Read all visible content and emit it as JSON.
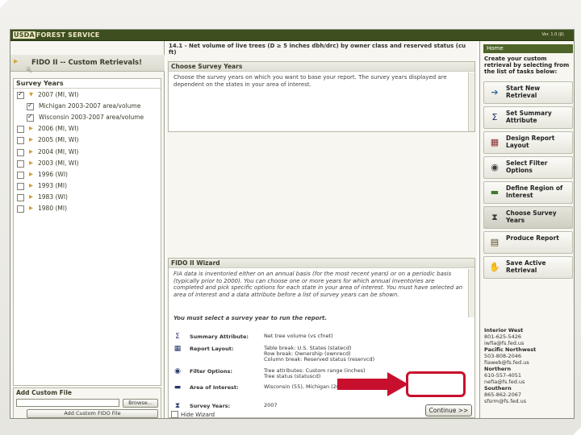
{
  "header": {
    "brand_usda": "USDA",
    "brand_name": "FOREST SERVICE",
    "version": "Ver. 1.0 (β)"
  },
  "left": {
    "title": "FIDO II -- Custom Retrievals!",
    "tree_header": "Survey Years",
    "rows": [
      {
        "label": "2007 (MI, WI)",
        "checked": true,
        "indent": 0,
        "expanded": true
      },
      {
        "label": "Michigan 2003-2007 area/volume",
        "checked": true,
        "indent": 1
      },
      {
        "label": "Wisconsin 2003-2007 area/volume",
        "checked": true,
        "indent": 1
      },
      {
        "label": "2006 (MI, WI)",
        "checked": false,
        "indent": 0
      },
      {
        "label": "2005 (MI, WI)",
        "checked": false,
        "indent": 0
      },
      {
        "label": "2004 (MI, WI)",
        "checked": false,
        "indent": 0
      },
      {
        "label": "2003 (MI, WI)",
        "checked": false,
        "indent": 0
      },
      {
        "label": "1996 (WI)",
        "checked": false,
        "indent": 0
      },
      {
        "label": "1993 (MI)",
        "checked": false,
        "indent": 0
      },
      {
        "label": "1983 (WI)",
        "checked": false,
        "indent": 0
      },
      {
        "label": "1980 (MI)",
        "checked": false,
        "indent": 0
      }
    ],
    "add_file": {
      "title": "Add Custom File",
      "browse_label": "Browse...",
      "add_label": "Add Custom FIDO File"
    }
  },
  "middle": {
    "report_title": "14.1 - Net volume of live trees (D ≥ 5 inches dbh/drc) by owner class and reserved status (cu ft)",
    "choose": {
      "title": "Choose Survey Years",
      "text": "Choose the survey years on which you want to base your report. The survey years displayed are dependent on the states in your area of interest."
    },
    "wizard": {
      "title": "FIDO II Wizard",
      "text": "FIA data is inventoried either on an annual basis (for the most recent years) or on a periodic basis (typically prior to 2000). You can choose one or more years for which annual inventories are completed and pick specific options for each state in your area of interest. You must have selected an area of interest and a data attribute before a list of survey years can be shown.",
      "must": "You must select a survey year to run the report.",
      "summary": [
        {
          "icon": "sigma-icon",
          "glyph": "Σ",
          "label": "Summary Attribute:",
          "value": "Net tree volume (vs cfnet)"
        },
        {
          "icon": "layout-icon",
          "glyph": "▦",
          "label": "Report Layout:",
          "value": "Table break: U.S. States (statecd)|Row break: Ownership (ownrecd)|Column break: Reserved status (reservcd)"
        },
        {
          "icon": "filter-icon",
          "glyph": "◉",
          "label": "Filter Options:",
          "value": "Tree attributes: Custom range (inches)|Tree status (statuscd)"
        },
        {
          "icon": "map-icon",
          "glyph": "▬",
          "label": "Area of Interest:",
          "value": "Wisconsin (55), Michigan (26)"
        },
        {
          "icon": "hourglass-icon",
          "glyph": "⧗",
          "label": "Survey Years:",
          "value": "2007"
        }
      ],
      "hide_label": "Hide Wizard",
      "continue_label": "Continue >>"
    }
  },
  "right": {
    "home_label": "Home",
    "intro": "Create your custom retrieval by selecting from the list of tasks below:",
    "tasks": [
      {
        "label": "Start New Retrieval",
        "icon": "start-icon",
        "glyph": "➔",
        "color": "#2c6aa0"
      },
      {
        "label": "Set Summary Attribute",
        "icon": "sigma-icon",
        "glyph": "Σ",
        "color": "#1c2e66"
      },
      {
        "label": "Design Report Layout",
        "icon": "layout-icon",
        "glyph": "▦",
        "color": "#8a2c2c"
      },
      {
        "label": "Select Filter Options",
        "icon": "filter-icon",
        "glyph": "◉",
        "color": "#3a3a3a"
      },
      {
        "label": "Define Region of Interest",
        "icon": "map-icon",
        "glyph": "▬",
        "color": "#3f7a2a"
      },
      {
        "label": "Choose Survey Years",
        "icon": "hourglass-icon",
        "glyph": "⧗",
        "color": "#3b3b3b"
      },
      {
        "label": "Produce Report",
        "icon": "report-icon",
        "glyph": "▤",
        "color": "#5a4a2a"
      },
      {
        "label": "Save Active Retrieval",
        "icon": "handshake-icon",
        "glyph": "✋",
        "color": "#b58b2c"
      }
    ],
    "contacts": [
      {
        "region": "Interior West",
        "lines": [
          "801-625-5426",
          "iwfia@fs.fed.us"
        ]
      },
      {
        "region": "Pacific Northwest",
        "lines": [
          "503-808-2046",
          "fiaweb@fs.fed.us"
        ]
      },
      {
        "region": "Northern",
        "lines": [
          "610-557-4051",
          "nefia@fs.fed.us"
        ]
      },
      {
        "region": "Southern",
        "lines": [
          "865-862-2067",
          "sfsrm@fs.fed.us"
        ]
      }
    ]
  },
  "colors": {
    "header": "#3d4f1f",
    "callout": "#c8102e"
  }
}
